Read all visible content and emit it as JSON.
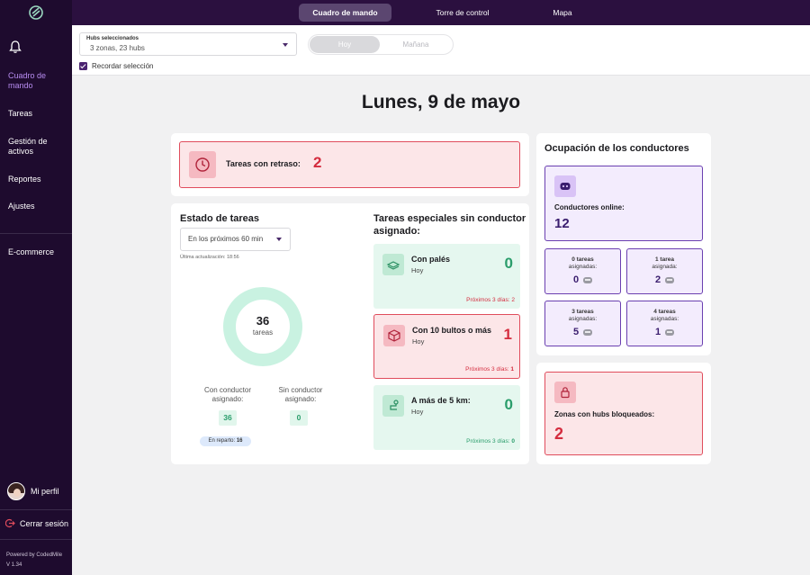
{
  "nav": {
    "notifications_icon": "bell-icon",
    "items": [
      {
        "label": "Cuadro de mando",
        "active": true
      },
      {
        "label": "Tareas",
        "active": false
      },
      {
        "label": "Gestión de activos",
        "active": false
      },
      {
        "label": "Reportes",
        "active": false
      },
      {
        "label": "Ajustes",
        "active": false
      },
      {
        "label": "E-commerce",
        "active": false
      }
    ],
    "profile_label": "Mi perfil",
    "logout_label": "Cerrar sesión",
    "powered_by": "Powered by CodedMile",
    "version": "V 1.34"
  },
  "topbar": {
    "tabs": [
      {
        "label": "Cuadro de mando",
        "active": true
      },
      {
        "label": "Torre de control",
        "active": false
      },
      {
        "label": "Mapa",
        "active": false
      }
    ]
  },
  "filters": {
    "hubs_label": "Hubs seleccionados",
    "hubs_value": "3 zonas, 23 hubs",
    "remember_label": "Recordar selección",
    "remember_checked": true,
    "day_options": [
      "Hoy",
      "Mañana"
    ],
    "day_selected": "Hoy"
  },
  "page_title": "Lunes, 9 de mayo",
  "overdue": {
    "label": "Tareas con retraso:",
    "value": "2"
  },
  "task_status": {
    "title": "Estado de tareas",
    "period": "En los próximos 60 min",
    "last_update": "Última actualización: 18:56",
    "total": "36",
    "total_label": "tareas",
    "with_driver_label": "Con conductor asignado:",
    "with_driver_value": "36",
    "without_driver_label": "Sin conductor asignado:",
    "without_driver_value": "0",
    "in_delivery_label": "En reparto:",
    "in_delivery_value": "16"
  },
  "special_tasks": {
    "title": "Tareas especiales sin conductor asignado:",
    "items": [
      {
        "title": "Con palés",
        "sub": "Hoy",
        "value": "0",
        "footer": "Próximos 3 días:",
        "footer_value": "2",
        "icon": "pallet-icon"
      },
      {
        "title": "Con 10 bultos o más",
        "sub": "Hoy",
        "value": "1",
        "footer": "Próximos 3 días:",
        "footer_value": "1",
        "icon": "box-icon"
      },
      {
        "title": "A más de 5 km:",
        "sub": "Hoy",
        "value": "0",
        "footer": "Próximos 3 días:",
        "footer_value": "0",
        "icon": "route-icon"
      }
    ]
  },
  "drivers": {
    "title": "Ocupación de los conductores",
    "online_label": "Conductores online:",
    "online_value": "12",
    "buckets": [
      {
        "label": "0 tareas",
        "sub": "asignadas:",
        "value": "0"
      },
      {
        "label": "1 tarea",
        "sub": "asignada:",
        "value": "2"
      },
      {
        "label": "3 tareas",
        "sub": "asignadas:",
        "value": "5"
      },
      {
        "label": "4 tareas",
        "sub": "asignadas:",
        "value": "1"
      }
    ]
  },
  "blocked": {
    "label": "Zonas con hubs bloqueados:",
    "value": "2"
  },
  "colors": {
    "sidebar": "#1e0b2e",
    "topbar": "#2b103f",
    "accent_purple": "#6a3fb0",
    "alert_red": "#d42c3e",
    "ok_green": "#2a9d6b",
    "donut": "#c9f2e1"
  }
}
